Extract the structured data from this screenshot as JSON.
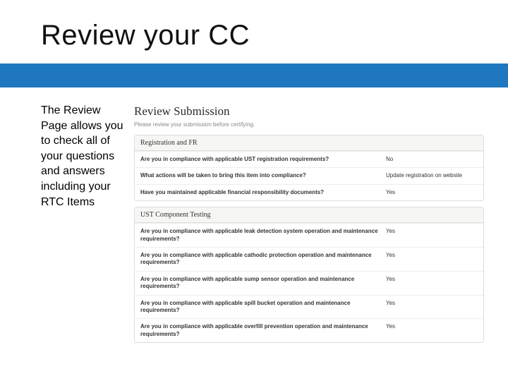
{
  "title": "Review your CC",
  "sidebar_text": "The Review Page allows you to check all of your questions and answers including your RTC Items",
  "screenshot": {
    "heading": "Review Submission",
    "subheading": "Please review your submission before certifying.",
    "sections": [
      {
        "title": "Registration and FR",
        "rows": [
          {
            "q": "Are you in compliance with applicable UST registration requirements?",
            "a": "No"
          },
          {
            "q": "What actions will be taken to bring this item into compliance?",
            "a": "Update registration on website"
          },
          {
            "q": "Have you maintained applicable financial responsibility documents?",
            "a": "Yes"
          }
        ]
      },
      {
        "title": "UST Component Testing",
        "rows": [
          {
            "q": "Are you in compliance with applicable leak detection system operation and maintenance requirements?",
            "a": "Yes"
          },
          {
            "q": "Are you in compliance with applicable cathodic protection operation and maintenance requirements?",
            "a": "Yes"
          },
          {
            "q": "Are you in compliance with applicable sump sensor operation and maintenance requirements?",
            "a": "Yes"
          },
          {
            "q": "Are you in compliance with applicable spill bucket operation and maintenance requirements?",
            "a": "Yes"
          },
          {
            "q": "Are you in compliance with applicable overfill prevention operation and maintenance requirements?",
            "a": "Yes"
          }
        ]
      }
    ]
  }
}
